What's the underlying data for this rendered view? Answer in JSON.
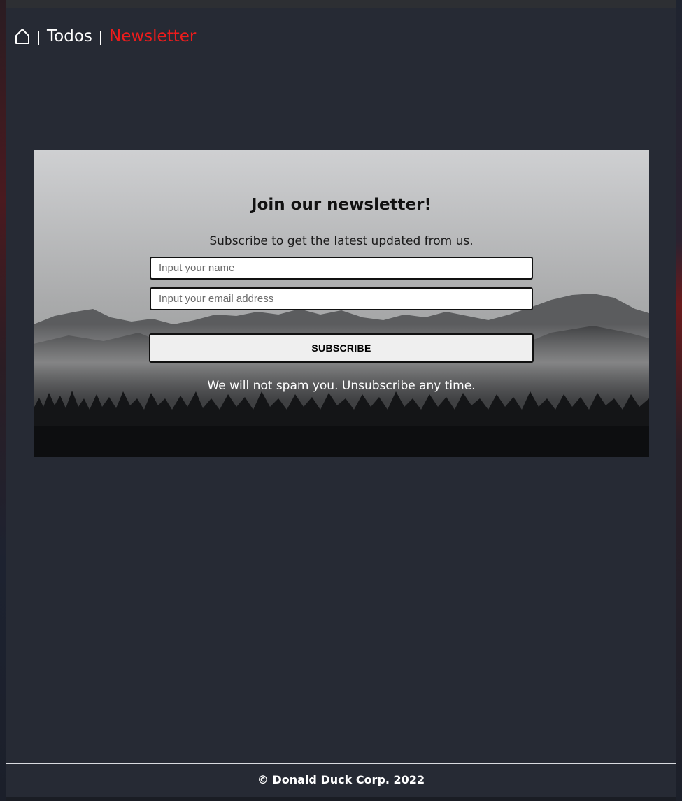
{
  "nav": {
    "home_icon": "home-icon",
    "links": [
      {
        "label": "Todos",
        "active": false
      },
      {
        "label": "Newsletter",
        "active": true
      }
    ],
    "active_color": "#ee1c1c"
  },
  "newsletter": {
    "title": "Join our newsletter!",
    "subtitle": "Subscribe to get the latest updated from us.",
    "name_placeholder": "Input your name",
    "email_placeholder": "Input your email address",
    "subscribe_label": "SUBSCRIBE",
    "note": "We will not spam you. Unsubscribe any time."
  },
  "footer": {
    "copyright": "© Donald Duck Corp. 2022"
  }
}
